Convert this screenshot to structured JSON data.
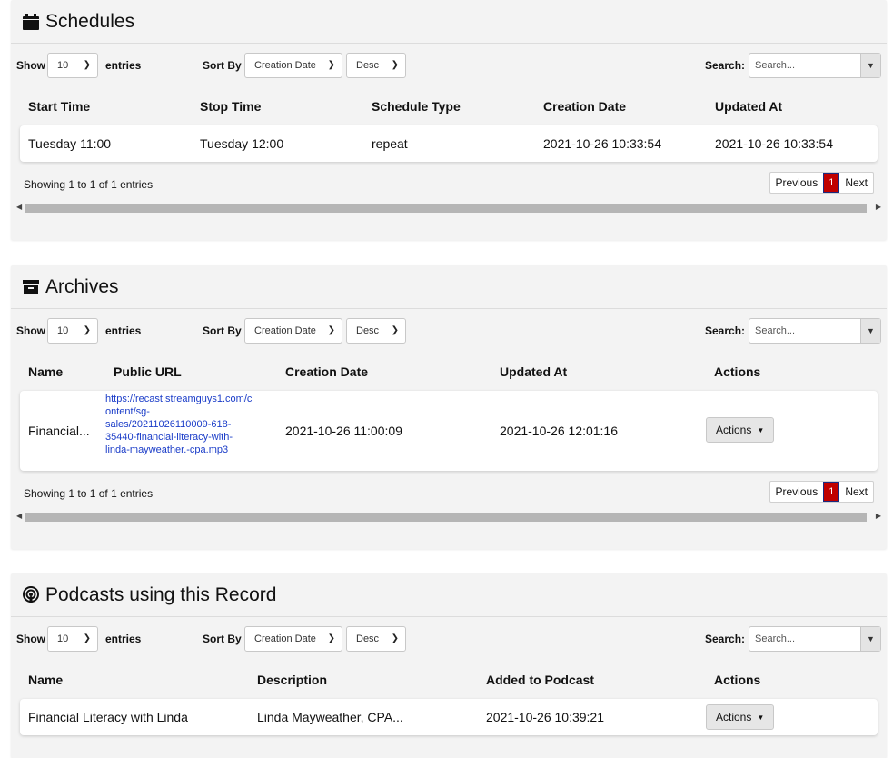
{
  "controls": {
    "show_label": "Show",
    "entries_value": "10",
    "entries_label": "entries",
    "sort_by_label": "Sort By",
    "sort_value": "Creation Date",
    "order_value": "Desc",
    "search_label": "Search:",
    "search_placeholder": "Search..."
  },
  "schedules": {
    "title": "Schedules",
    "columns": [
      "Start Time",
      "Stop Time",
      "Schedule Type",
      "Creation Date",
      "Updated At"
    ],
    "rows": [
      [
        "Tuesday 11:00",
        "Tuesday 12:00",
        "repeat",
        "2021-10-26 10:33:54",
        "2021-10-26 10:33:54"
      ]
    ],
    "info": "Showing 1 to 1 of 1 entries"
  },
  "archives": {
    "title": "Archives",
    "columns": [
      "Name",
      "Public URL",
      "Creation Date",
      "Updated At",
      "Actions"
    ],
    "rows": [
      {
        "name": "Financial...",
        "url_lines": [
          "https://recast.streamguys1.com/c",
          "ontent/sg-",
          "sales/20211026110009-618-",
          "35440-financial-literacy-with-",
          "linda-mayweather.-cpa.mp3"
        ],
        "created": "2021-10-26 11:00:09",
        "updated": "2021-10-26 12:01:16",
        "actions": "Actions"
      }
    ],
    "info": "Showing 1 to 1 of 1 entries"
  },
  "podcasts": {
    "title": "Podcasts using this Record",
    "columns": [
      "Name",
      "Description",
      "Added to Podcast",
      "Actions"
    ],
    "rows": [
      {
        "name": "Financial Literacy with Linda",
        "description": "Linda Mayweather, CPA...",
        "added": "2021-10-26 10:39:21",
        "actions": "Actions"
      }
    ]
  },
  "pagination": {
    "previous": "Previous",
    "current": "1",
    "next": "Next"
  }
}
